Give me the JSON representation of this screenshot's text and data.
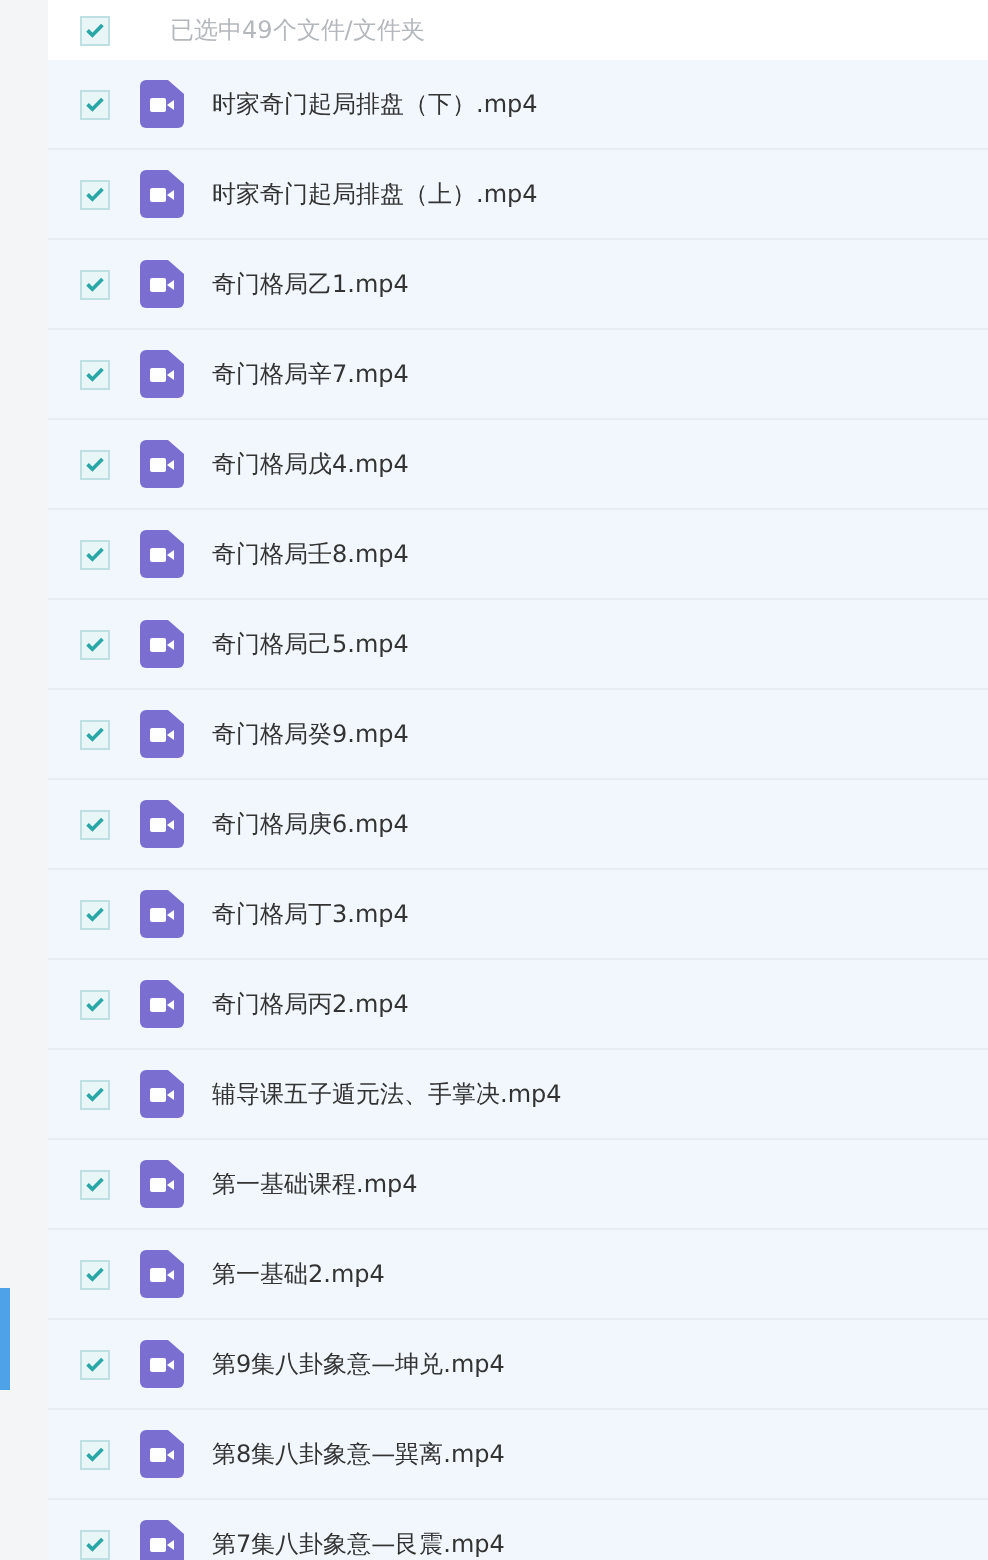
{
  "header": {
    "checked": true,
    "label": "已选中49个文件/文件夹"
  },
  "files": [
    {
      "name": "时家奇门起局排盘（下）.mp4",
      "checked": true
    },
    {
      "name": "时家奇门起局排盘（上）.mp4",
      "checked": true
    },
    {
      "name": "奇门格局乙1.mp4",
      "checked": true
    },
    {
      "name": "奇门格局辛7.mp4",
      "checked": true
    },
    {
      "name": "奇门格局戊4.mp4",
      "checked": true
    },
    {
      "name": "奇门格局壬8.mp4",
      "checked": true
    },
    {
      "name": "奇门格局己5.mp4",
      "checked": true
    },
    {
      "name": "奇门格局癸9.mp4",
      "checked": true
    },
    {
      "name": "奇门格局庚6.mp4",
      "checked": true
    },
    {
      "name": "奇门格局丁3.mp4",
      "checked": true
    },
    {
      "name": "奇门格局丙2.mp4",
      "checked": true
    },
    {
      "name": "辅导课五子遁元法、手掌决.mp4",
      "checked": true
    },
    {
      "name": "第一基础课程.mp4",
      "checked": true
    },
    {
      "name": "第一基础2.mp4",
      "checked": true
    },
    {
      "name": "第9集八卦象意—坤兑.mp4",
      "checked": true
    },
    {
      "name": "第8集八卦象意—巽离.mp4",
      "checked": true
    },
    {
      "name": "第7集八卦象意—艮震.mp4",
      "checked": true
    }
  ]
}
